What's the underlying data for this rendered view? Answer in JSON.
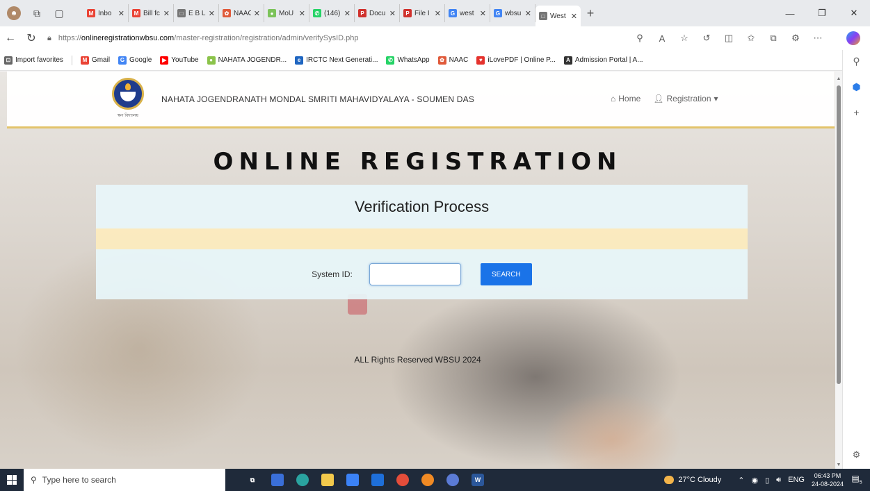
{
  "browser": {
    "tabs": [
      {
        "label": "Inbo",
        "icon": "gmail-icon",
        "color": "#ea4335",
        "glyph": "M"
      },
      {
        "label": "Bill fc",
        "icon": "gmail-icon",
        "color": "#ea4335",
        "glyph": "M"
      },
      {
        "label": "E B L",
        "icon": "page-icon",
        "color": "#777777",
        "glyph": "□"
      },
      {
        "label": "NAAC",
        "icon": "naac-icon",
        "color": "#e05a3a",
        "glyph": "✿"
      },
      {
        "label": "MoU",
        "icon": "circle-icon",
        "color": "#7cc35a",
        "glyph": "●"
      },
      {
        "label": "(146)",
        "icon": "whatsapp-icon",
        "color": "#25d366",
        "glyph": "✆"
      },
      {
        "label": "Docu",
        "icon": "pdf-icon",
        "color": "#d0312d",
        "glyph": "P"
      },
      {
        "label": "File I",
        "icon": "pdf-icon",
        "color": "#d0312d",
        "glyph": "P"
      },
      {
        "label": "west",
        "icon": "google-icon",
        "color": "#4285f4",
        "glyph": "G"
      },
      {
        "label": "wbsu",
        "icon": "google-icon",
        "color": "#4285f4",
        "glyph": "G"
      },
      {
        "label": "West",
        "icon": "page-icon",
        "color": "#777777",
        "glyph": "□",
        "active": true
      }
    ],
    "new_tab": "+",
    "address": {
      "scheme": "https://",
      "host": "onlineregistrationwbsu.com",
      "path": "/master-registration/registration/admin/verifySysID.php"
    },
    "favorites": [
      {
        "label": "Import favorites",
        "icon": "folder-icon",
        "color": "#666666",
        "glyph": "⊡"
      },
      {
        "label": "Gmail",
        "icon": "gmail-icon",
        "color": "#ea4335",
        "glyph": "M"
      },
      {
        "label": "Google",
        "icon": "google-icon",
        "color": "#4285f4",
        "glyph": "G"
      },
      {
        "label": "YouTube",
        "icon": "youtube-icon",
        "color": "#ff0000",
        "glyph": "▶"
      },
      {
        "label": "NAHATA JOGENDR...",
        "icon": "circle-icon",
        "color": "#8bc34a",
        "glyph": "●"
      },
      {
        "label": "IRCTC Next Generati...",
        "icon": "irctc-icon",
        "color": "#1f66c1",
        "glyph": "e"
      },
      {
        "label": "WhatsApp",
        "icon": "whatsapp-icon",
        "color": "#25d366",
        "glyph": "✆"
      },
      {
        "label": "NAAC",
        "icon": "naac-icon",
        "color": "#e05a3a",
        "glyph": "✿"
      },
      {
        "label": "iLovePDF | Online P...",
        "icon": "ilovepdf-icon",
        "color": "#e5322d",
        "glyph": "♥"
      },
      {
        "label": "Admission Portal | A...",
        "icon": "portal-icon",
        "color": "#333333",
        "glyph": "A"
      }
    ]
  },
  "site": {
    "logo_caption": "ক্ষণ বিদ্যালয়",
    "title": "NAHATA JOGENDRANATH MONDAL SMRITI MAHAVIDYALAYA - SOUMEN DAS",
    "nav_home": "Home",
    "nav_registration": "Registration",
    "hero": "ONLINE REGISTRATION",
    "panel_title": "Verification Process",
    "system_id_label": "System ID:",
    "system_id_value": "",
    "search_button": "SEARCH",
    "copyright": "ALL Rights Reserved WBSU 2024",
    "accent_color": "#e3c36a",
    "button_color": "#1a73e8"
  },
  "taskbar": {
    "search_placeholder": "Type here to search",
    "weather": "27°C Cloudy",
    "language": "ENG",
    "time": "06:43 PM",
    "date": "24-08-2024",
    "notification_count": "5"
  }
}
